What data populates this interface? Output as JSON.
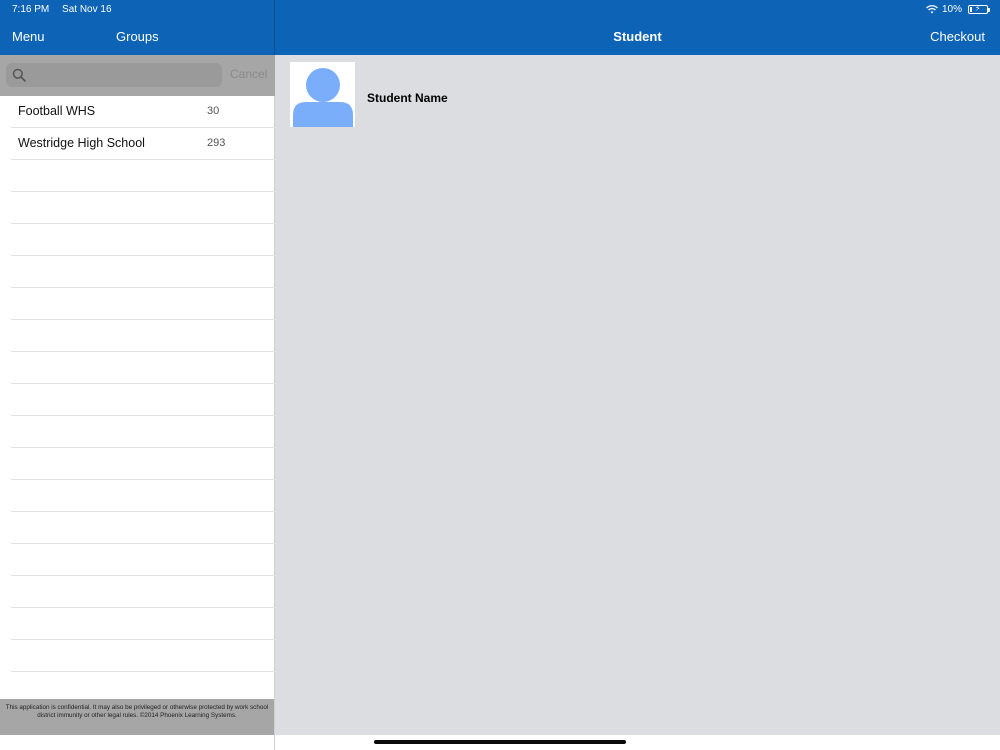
{
  "status_bar": {
    "time": "7:16 PM",
    "date": "Sat Nov 16",
    "battery_text": "10%",
    "battery_level": 0.1
  },
  "nav": {
    "menu_label": "Menu",
    "groups_label": "Groups",
    "title": "Student",
    "checkout_label": "Checkout"
  },
  "search": {
    "placeholder": "",
    "value": "",
    "cancel_label": "Cancel"
  },
  "groups": [
    {
      "name": "Football WHS",
      "count": "30"
    },
    {
      "name": "Westridge High School",
      "count": "293"
    }
  ],
  "footer": {
    "text": "This application is confidential. It may also be privileged or otherwise protected by work school district immunity or other legal rules. ©2014 Phoenix Learning Systems."
  },
  "student": {
    "name": "Student Name"
  },
  "colors": {
    "header": "#0d63b6",
    "avatar": "#7aadfa",
    "panel_background": "#dcdde0",
    "search_bar": "#a6a6a6"
  },
  "icons": {
    "search": "search-icon",
    "wifi": "wifi-icon",
    "battery": "battery-icon",
    "avatar": "person-silhouette"
  }
}
